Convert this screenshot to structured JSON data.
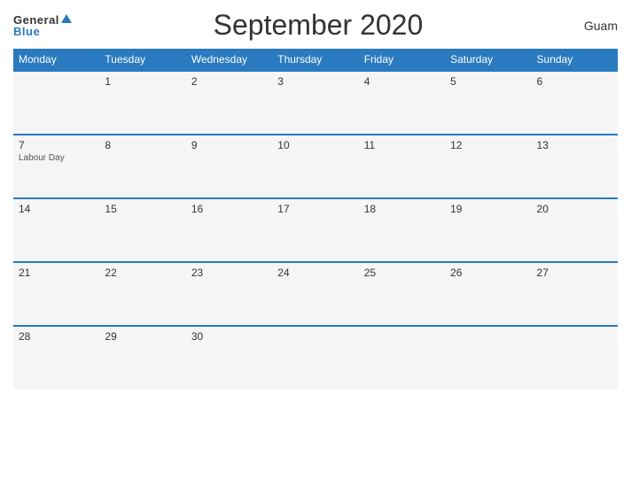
{
  "header": {
    "logo_general": "General",
    "logo_blue": "Blue",
    "title": "September 2020",
    "region": "Guam"
  },
  "weekdays": [
    "Monday",
    "Tuesday",
    "Wednesday",
    "Thursday",
    "Friday",
    "Saturday",
    "Sunday"
  ],
  "weeks": [
    [
      {
        "day": "",
        "holiday": ""
      },
      {
        "day": "1",
        "holiday": ""
      },
      {
        "day": "2",
        "holiday": ""
      },
      {
        "day": "3",
        "holiday": ""
      },
      {
        "day": "4",
        "holiday": ""
      },
      {
        "day": "5",
        "holiday": ""
      },
      {
        "day": "6",
        "holiday": ""
      }
    ],
    [
      {
        "day": "7",
        "holiday": "Labour Day"
      },
      {
        "day": "8",
        "holiday": ""
      },
      {
        "day": "9",
        "holiday": ""
      },
      {
        "day": "10",
        "holiday": ""
      },
      {
        "day": "11",
        "holiday": ""
      },
      {
        "day": "12",
        "holiday": ""
      },
      {
        "day": "13",
        "holiday": ""
      }
    ],
    [
      {
        "day": "14",
        "holiday": ""
      },
      {
        "day": "15",
        "holiday": ""
      },
      {
        "day": "16",
        "holiday": ""
      },
      {
        "day": "17",
        "holiday": ""
      },
      {
        "day": "18",
        "holiday": ""
      },
      {
        "day": "19",
        "holiday": ""
      },
      {
        "day": "20",
        "holiday": ""
      }
    ],
    [
      {
        "day": "21",
        "holiday": ""
      },
      {
        "day": "22",
        "holiday": ""
      },
      {
        "day": "23",
        "holiday": ""
      },
      {
        "day": "24",
        "holiday": ""
      },
      {
        "day": "25",
        "holiday": ""
      },
      {
        "day": "26",
        "holiday": ""
      },
      {
        "day": "27",
        "holiday": ""
      }
    ],
    [
      {
        "day": "28",
        "holiday": ""
      },
      {
        "day": "29",
        "holiday": ""
      },
      {
        "day": "30",
        "holiday": ""
      },
      {
        "day": "",
        "holiday": ""
      },
      {
        "day": "",
        "holiday": ""
      },
      {
        "day": "",
        "holiday": ""
      },
      {
        "day": "",
        "holiday": ""
      }
    ]
  ]
}
